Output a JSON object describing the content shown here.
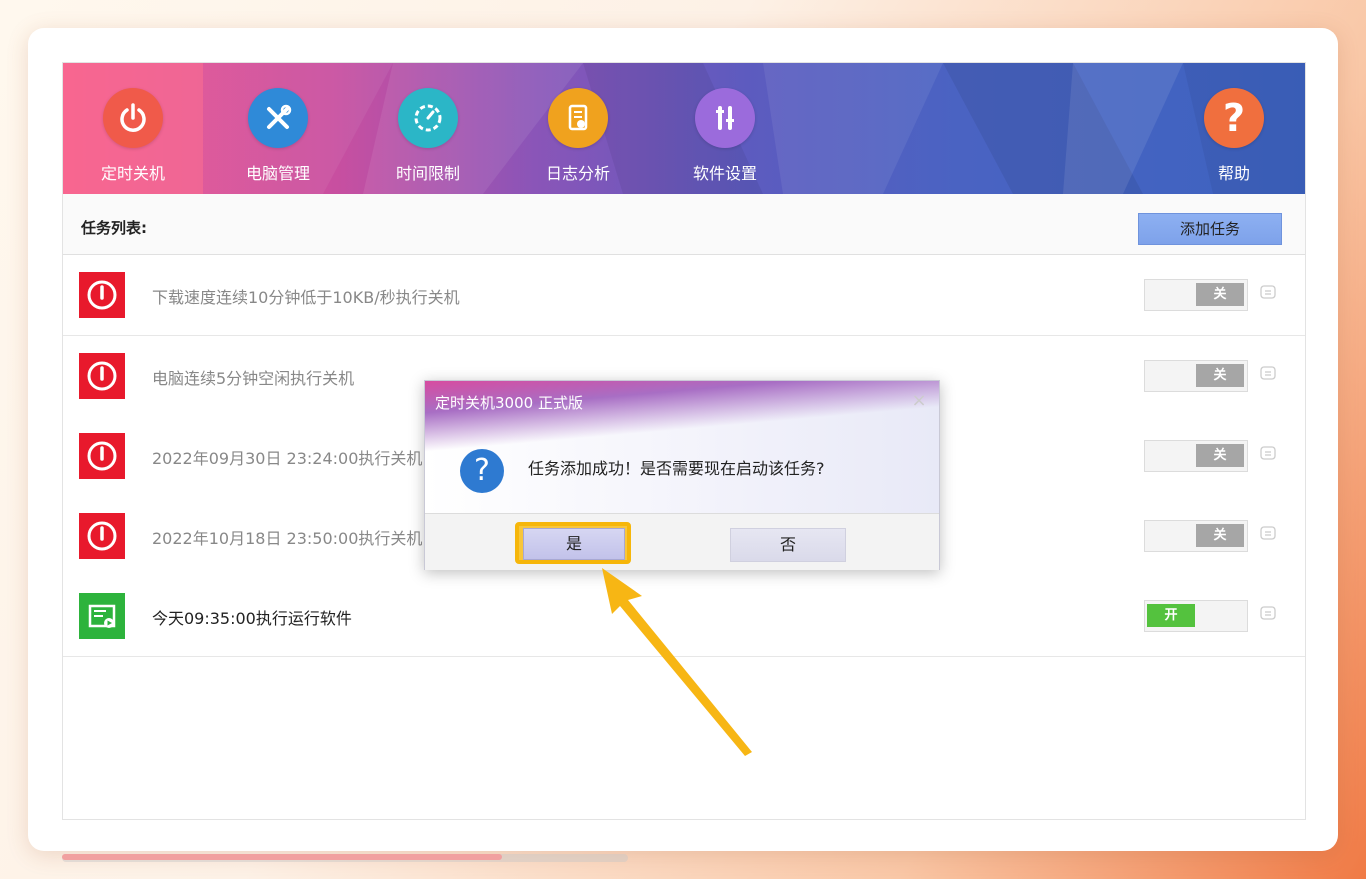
{
  "nav": {
    "items": [
      {
        "label": "定时关机",
        "icon": "power-icon",
        "color": "#f05a4a"
      },
      {
        "label": "电脑管理",
        "icon": "tools-icon",
        "color": "#2f8ad8"
      },
      {
        "label": "时间限制",
        "icon": "timer-icon",
        "color": "#2bb6c7"
      },
      {
        "label": "日志分析",
        "icon": "log-icon",
        "color": "#f0a21e"
      },
      {
        "label": "软件设置",
        "icon": "settings-tools-icon",
        "color": "#9b6bdc"
      }
    ],
    "help": {
      "label": "帮助",
      "icon": "help-icon",
      "color": "#f06f3e"
    }
  },
  "list": {
    "title": "任务列表:",
    "add_button": "添加任务"
  },
  "tasks": [
    {
      "text": "下载速度连续10分钟低于10KB/秒执行关机",
      "type": "shutdown",
      "toggle": "关",
      "enabled": false
    },
    {
      "text": "电脑连续5分钟空闲执行关机",
      "type": "shutdown",
      "toggle": "关",
      "enabled": false
    },
    {
      "text": "2022年09月30日 23:24:00执行关机",
      "type": "shutdown",
      "toggle": "关",
      "enabled": false
    },
    {
      "text": "2022年10月18日 23:50:00执行关机",
      "type": "shutdown",
      "toggle": "关",
      "enabled": false
    },
    {
      "text": "今天09:35:00执行运行软件",
      "type": "run-software",
      "toggle": "开",
      "enabled": true
    }
  ],
  "dialog": {
    "title": "定时关机3000 正式版",
    "message": "任务添加成功！是否需要现在启动该任务?",
    "yes": "是",
    "no": "否"
  },
  "colors": {
    "shutdown_red": "#e8192c",
    "run_green": "#2db33c",
    "highlight": "#f6b60a"
  }
}
